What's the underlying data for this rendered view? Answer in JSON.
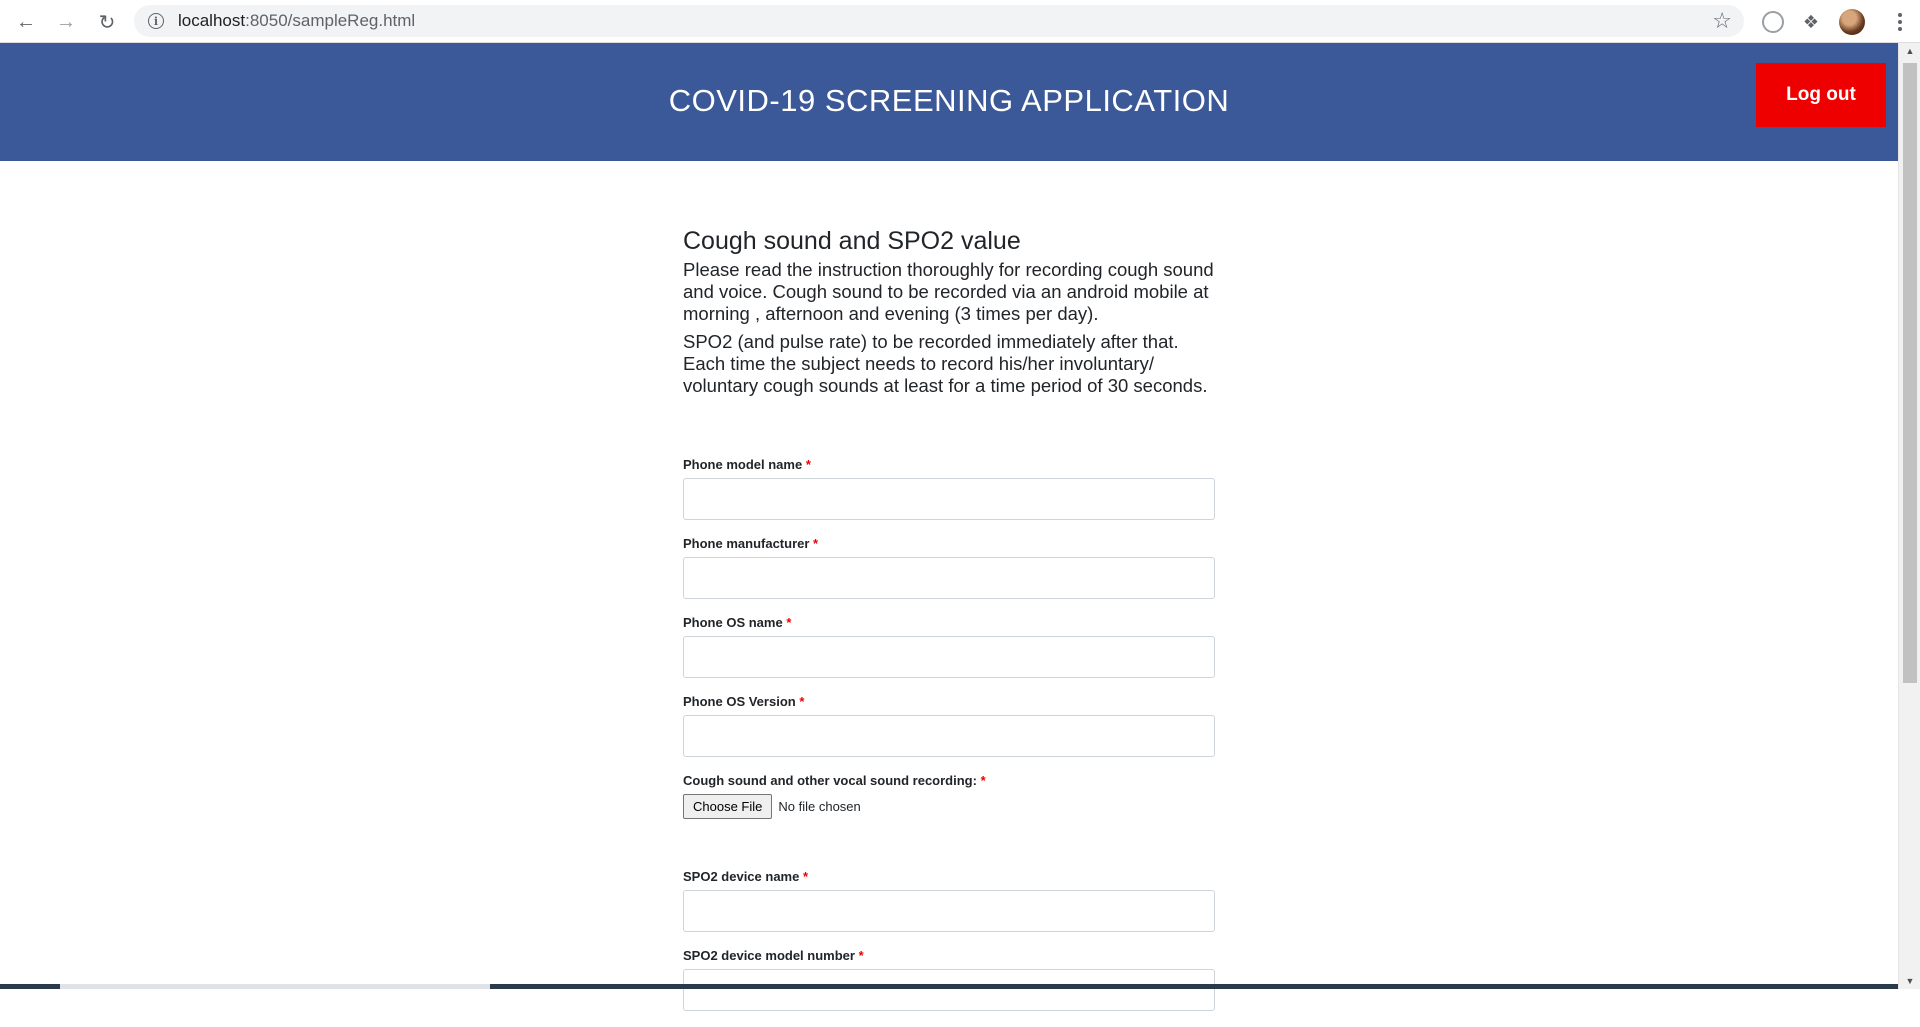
{
  "browser": {
    "url_host": "localhost",
    "url_path": ":8050/sampleReg.html"
  },
  "header": {
    "title": "COVID-19 SCREENING APPLICATION",
    "logout_label": "Log out"
  },
  "main": {
    "section_title": "Cough sound and SPO2 value",
    "instruction_1": "Please read the instruction thoroughly for recording cough sound and voice. Cough sound to be recorded via an android mobile at morning , afternoon and evening (3 times per day).",
    "instruction_2": "SPO2 (and pulse rate) to be recorded immediately after that. Each time the subject needs to record his/her involuntary/ voluntary cough sounds at least for a time period of 30 seconds."
  },
  "form": {
    "required_mark": "*",
    "phone_model_label": "Phone model name",
    "phone_manufacturer_label": "Phone manufacturer",
    "phone_os_name_label": "Phone OS name",
    "phone_os_version_label": "Phone OS Version",
    "recording_label": "Cough sound and other vocal sound recording:",
    "choose_file_label": "Choose File",
    "file_status": "No file chosen",
    "spo2_device_name_label": "SPO2 device name",
    "spo2_device_model_label": "SPO2 device model number"
  }
}
